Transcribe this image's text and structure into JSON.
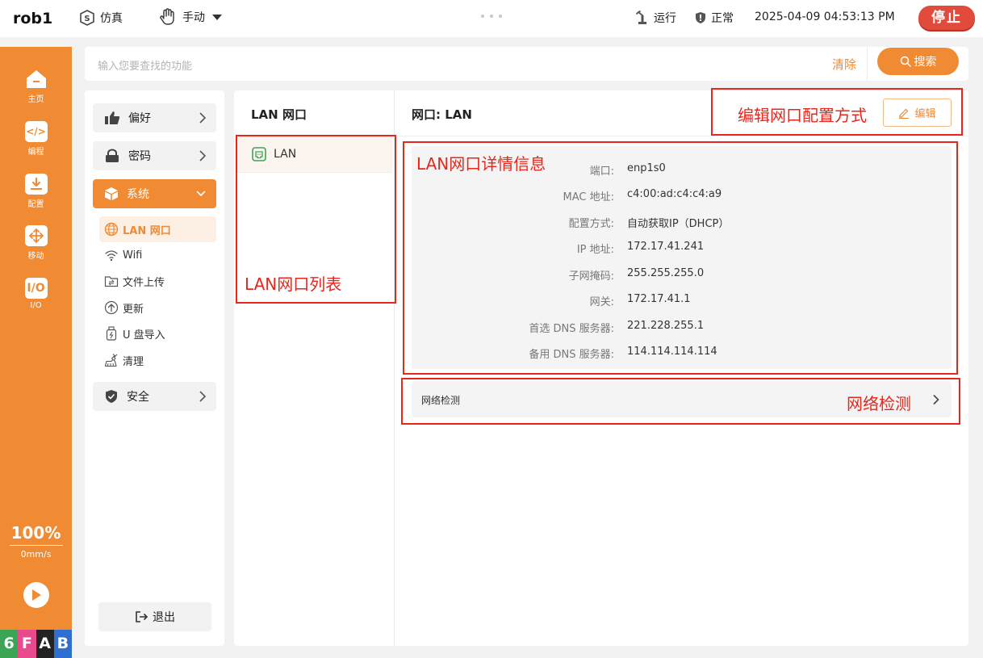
{
  "topbar": {
    "robot_name": "rob1",
    "simulation_label": "仿真",
    "mode_label": "手动",
    "run_status_label": "运行",
    "health_status_label": "正常",
    "datetime": "2025-04-09 04:53:13 PM",
    "stop_label": "停止"
  },
  "rail": {
    "items": [
      {
        "label": "主页",
        "icon": "home-icon"
      },
      {
        "label": "编程",
        "icon": "code-icon"
      },
      {
        "label": "配置",
        "icon": "config-icon"
      },
      {
        "label": "移动",
        "icon": "move-icon"
      },
      {
        "label": "I/O",
        "icon": "io-icon"
      }
    ],
    "io_glyph": "I/O",
    "speed_percent": "100%",
    "speed_value": "0mm/s",
    "logo_letters": [
      "6",
      "F",
      "A",
      "B"
    ],
    "logo_colors": [
      "#3aa655",
      "#e9498d",
      "#222222",
      "#2f6fd1"
    ]
  },
  "search": {
    "placeholder": "输入您要查找的功能",
    "clear_label": "清除",
    "search_label": "搜索"
  },
  "menu": {
    "groups": [
      {
        "label": "偏好",
        "icon": "thumbs-up-icon"
      },
      {
        "label": "密码",
        "icon": "lock-icon"
      },
      {
        "label": "系统",
        "icon": "cube-icon"
      },
      {
        "label": "安全",
        "icon": "shield-icon"
      }
    ],
    "submenu": [
      {
        "label": "LAN 网口",
        "icon": "globe-icon"
      },
      {
        "label": "Wifi",
        "icon": "wifi-icon"
      },
      {
        "label": "文件上传",
        "icon": "folder-upload-icon"
      },
      {
        "label": "更新",
        "icon": "upload-circle-icon"
      },
      {
        "label": "U 盘导入",
        "icon": "usb-icon"
      },
      {
        "label": "清理",
        "icon": "brush-icon"
      }
    ],
    "logout_label": "退出"
  },
  "lan_list": {
    "title": "LAN 网口",
    "items": [
      {
        "label": "LAN",
        "icon": "ethernet-port-icon"
      }
    ]
  },
  "detail": {
    "title": "网口:  LAN",
    "edit_label": "编辑",
    "rows": [
      {
        "label": "端口:",
        "value": "enp1s0"
      },
      {
        "label": "MAC 地址:",
        "value": "c4:00:ad:c4:c4:a9"
      },
      {
        "label": "配置方式:",
        "value": "自动获取IP（DHCP）"
      },
      {
        "label": "IP 地址:",
        "value": "172.17.41.241"
      },
      {
        "label": "子网掩码:",
        "value": "255.255.255.0"
      },
      {
        "label": "网关:",
        "value": "172.17.41.1"
      },
      {
        "label": "首选 DNS 服务器:",
        "value": "221.228.255.1"
      },
      {
        "label": "备用 DNS 服务器:",
        "value": "114.114.114.114"
      }
    ],
    "net_check_label": "网络检测"
  },
  "annotations": {
    "edit_config": "编辑网口配置方式",
    "details": "LAN网口详情信息",
    "list": "LAN网口列表",
    "net_check": "网络检测",
    "color": "#e8261c"
  },
  "colors": {
    "accent": "#f08a33",
    "stop": "#e24a3b"
  }
}
